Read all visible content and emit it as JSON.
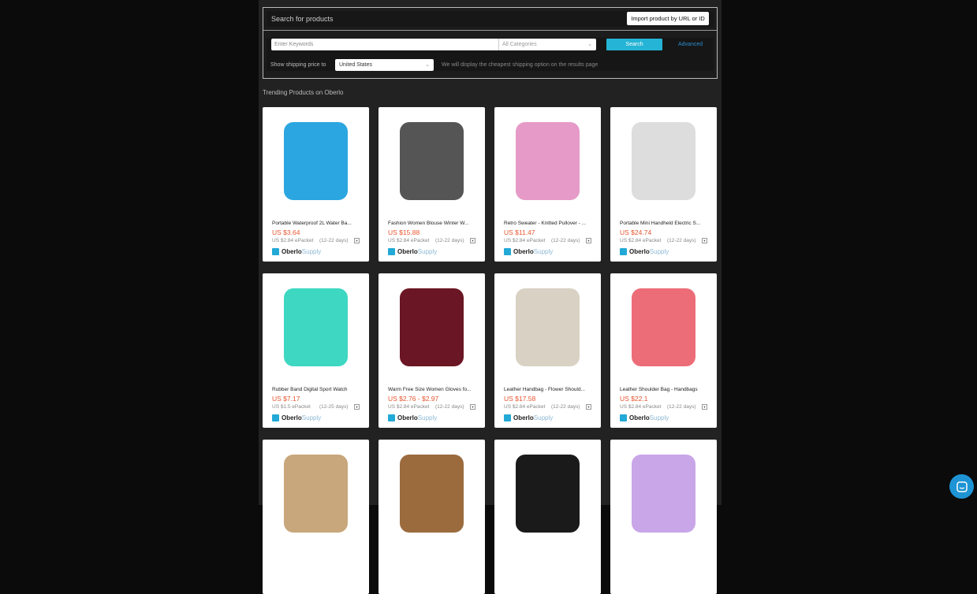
{
  "search": {
    "title": "Search for products",
    "import_label": "Import product by URL or ID",
    "keywords_placeholder": "Enter Keywords",
    "category": "All Categories",
    "search_label": "Search",
    "advanced_label": "Advanced",
    "shipping_label": "Show shipping price to",
    "shipping_country": "United States",
    "shipping_note": "We will display the cheapest shipping option on the results page"
  },
  "section_title": "Trending Products on Oberlo",
  "brand": {
    "a": "Oberlo",
    "b": "Supply"
  },
  "products": [
    {
      "name": "Portable Waterproof 2L Water Ba...",
      "price": "US $3.64",
      "shipping": "US $2.84 ePacket",
      "days": "(12-22 days)",
      "color": "#2ba6e0"
    },
    {
      "name": "Fashion Women Blouse Winter W...",
      "price": "US $15.88",
      "shipping": "US $2.84 ePacket",
      "days": "(12-22 days)",
      "color": "#555555"
    },
    {
      "name": "Retro Sweater - Knitted Pullover - ...",
      "price": "US $11.47",
      "shipping": "US $2.84 ePacket",
      "days": "(12-22 days)",
      "color": "#e59ac7"
    },
    {
      "name": "Portable Mini Handheld Electric S...",
      "price": "US $24.74",
      "shipping": "US $2.84 ePacket",
      "days": "(12-22 days)",
      "color": "#dddddd"
    },
    {
      "name": "Rubber Band Digital Sport Watch",
      "price": "US $7.17",
      "shipping": "US $1.5 ePacket",
      "days": "(12-25 days)",
      "color": "#3ed7c2"
    },
    {
      "name": "Warm Free Size Women Gloves fo...",
      "price": "US $2.76 - $2.97",
      "shipping": "US $2.84 ePacket",
      "days": "(12-22 days)",
      "color": "#6b1624"
    },
    {
      "name": "Leather Handbag - Flower Should...",
      "price": "US $17.58",
      "shipping": "US $2.84 ePacket",
      "days": "(12-22 days)",
      "color": "#d9d2c4"
    },
    {
      "name": "Leather Shoulder Bag - Handbags",
      "price": "US $22.1",
      "shipping": "US $2.84 ePacket",
      "days": "(12-22 days)",
      "color": "#ec6d78"
    },
    {
      "name": "",
      "price": "",
      "shipping": "",
      "days": "",
      "color": "#c8a77c"
    },
    {
      "name": "",
      "price": "",
      "shipping": "",
      "days": "",
      "color": "#9b6b3e"
    },
    {
      "name": "",
      "price": "",
      "shipping": "",
      "days": "",
      "color": "#1a1a1a"
    },
    {
      "name": "",
      "price": "",
      "shipping": "",
      "days": "",
      "color": "#c9a6e8"
    }
  ]
}
